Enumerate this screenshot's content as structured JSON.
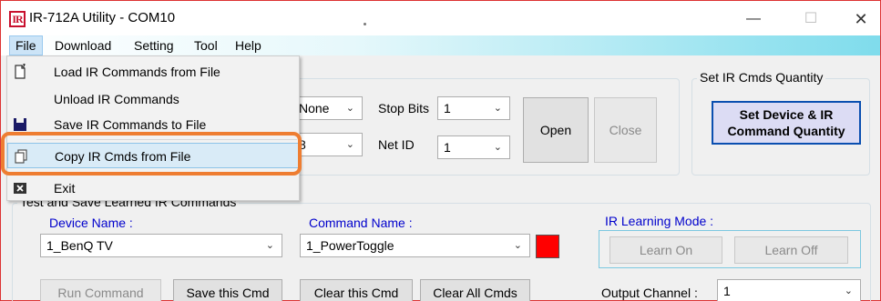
{
  "window": {
    "title": "IR-712A Utility - COM10",
    "logo_text": "IR",
    "minimize_glyph": "—",
    "maximize_glyph": "☐",
    "close_glyph": "✕"
  },
  "menubar": {
    "items": [
      "File",
      "Download",
      "Setting",
      "Tool",
      "Help"
    ]
  },
  "file_menu": {
    "items": [
      {
        "label": "Load IR Commands from File",
        "icon": "load-file-icon"
      },
      {
        "label": "Unload IR Commands",
        "icon": ""
      },
      {
        "label": "Save IR Commands to File",
        "icon": "save-disk-icon"
      },
      {
        "label": "Copy IR Cmds from File",
        "icon": "copy-icon",
        "highlighted": true
      },
      {
        "label": "Exit",
        "icon": "exit-icon"
      }
    ]
  },
  "serial": {
    "parity_value": "None",
    "stop_bits_label": "Stop Bits",
    "stop_bits_value": "1",
    "data_bits_value": "8",
    "net_id_label": "Net ID",
    "net_id_value": "1",
    "open_label": "Open",
    "close_label": "Close"
  },
  "quantity": {
    "legend": "Set IR Cmds Quantity",
    "button_line1": "Set Device & IR",
    "button_line2": "Command Quantity"
  },
  "learn_group": {
    "legend": "Test and Save Learned IR Commands",
    "device_label": "Device Name :",
    "device_value": "1_BenQ TV",
    "command_label": "Command Name :",
    "command_value": "1_PowerToggle",
    "command_color": "#ff0000",
    "mode_label": "IR Learning Mode :",
    "learn_on": "Learn On",
    "learn_off": "Learn Off",
    "run_command": "Run Command",
    "save_cmd": "Save this Cmd",
    "clear_cmd": "Clear this Cmd",
    "clear_all": "Clear All Cmds",
    "output_label": "Output Channel :",
    "output_value": "1"
  },
  "colors": {
    "accent_highlight": "#ee7d31",
    "brand_red": "#c8102e"
  }
}
